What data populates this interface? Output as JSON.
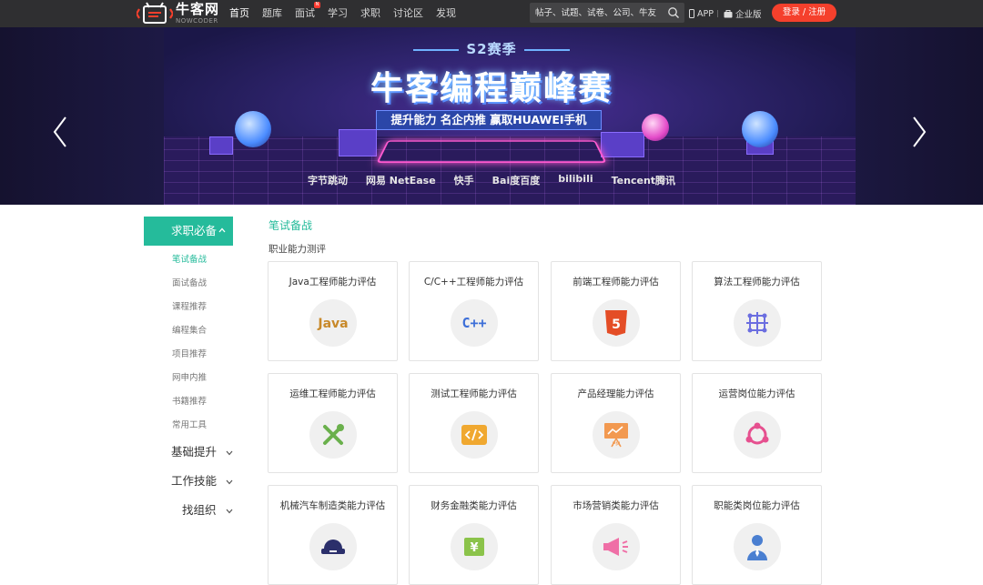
{
  "header": {
    "logo_cn": "牛客网",
    "logo_en": "NOWCODER",
    "nav": [
      {
        "label": "首页",
        "active": true
      },
      {
        "label": "题库",
        "active": false
      },
      {
        "label": "面试",
        "active": false,
        "badge": "N"
      },
      {
        "label": "学习",
        "active": false
      },
      {
        "label": "求职",
        "active": false
      },
      {
        "label": "讨论区",
        "active": false
      },
      {
        "label": "发现",
        "active": false
      }
    ],
    "search_placeholder": "帖子、试题、试卷、公司、牛友",
    "app_label": "APP",
    "enterprise_label": "企业版",
    "login_label": "登录 / 注册",
    "accent": "#f5402c"
  },
  "banner": {
    "season": "S2赛季",
    "headline": "牛客编程巅峰赛",
    "subline": "提升能力  名企内推  赢取HUAWEI手机",
    "sponsors": [
      "字节跳动",
      "网易 NetEase",
      "快手",
      "Bai度百度",
      "bilibili",
      "Tencent腾讯"
    ]
  },
  "sidebar": {
    "head": "求职必备",
    "items": [
      {
        "label": "笔试备战",
        "active": true
      },
      {
        "label": "面试备战",
        "active": false
      },
      {
        "label": "课程推荐",
        "active": false
      },
      {
        "label": "编程集合",
        "active": false
      },
      {
        "label": "项目推荐",
        "active": false
      },
      {
        "label": "网申内推",
        "active": false
      },
      {
        "label": "书籍推荐",
        "active": false
      },
      {
        "label": "常用工具",
        "active": false
      }
    ],
    "groups": [
      "基础提升",
      "工作技能",
      "找组织"
    ],
    "accent": "#25bb9b"
  },
  "main": {
    "section_title": "笔试备战",
    "sub_title": "职业能力测评",
    "cards": [
      {
        "title": "Java工程师能力评估",
        "icon": "java-icon"
      },
      {
        "title": "C/C++工程师能力评估",
        "icon": "cpp-icon"
      },
      {
        "title": "前端工程师能力评估",
        "icon": "html5-icon"
      },
      {
        "title": "算法工程师能力评估",
        "icon": "algorithm-icon"
      },
      {
        "title": "运维工程师能力评估",
        "icon": "wrench-icon"
      },
      {
        "title": "测试工程师能力评估",
        "icon": "code-icon"
      },
      {
        "title": "产品经理能力评估",
        "icon": "pm-board-icon"
      },
      {
        "title": "运营岗位能力评估",
        "icon": "share-nodes-icon"
      },
      {
        "title": "机械汽车制造类能力评估",
        "icon": "vehicle-icon"
      },
      {
        "title": "财务金融类能力评估",
        "icon": "yuan-icon"
      },
      {
        "title": "市场营销类能力评估",
        "icon": "megaphone-icon"
      },
      {
        "title": "职能类岗位能力评估",
        "icon": "person-icon"
      }
    ]
  }
}
